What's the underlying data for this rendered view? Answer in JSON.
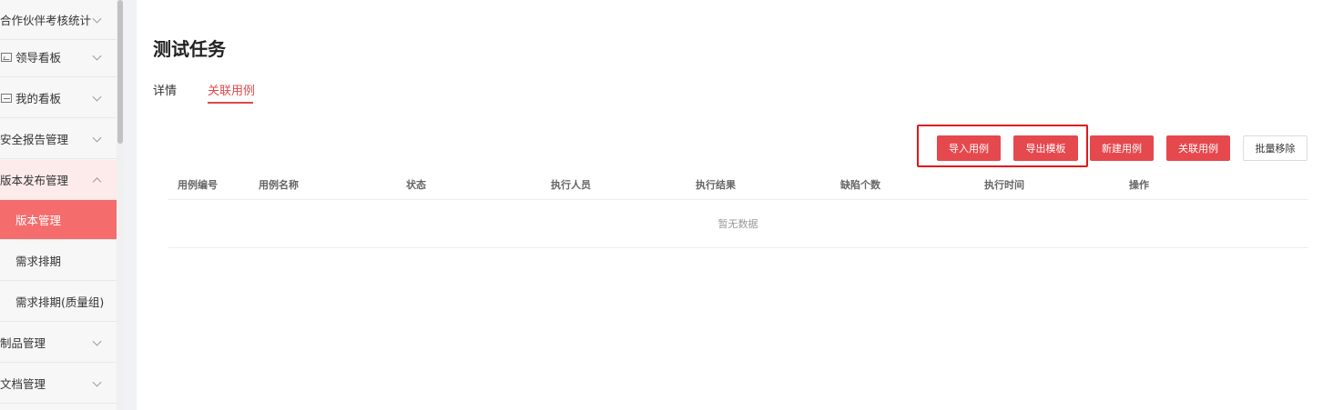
{
  "sidebar": {
    "items": [
      {
        "label": "合作伙伴考核统计",
        "type": "group"
      },
      {
        "label": "领导看板",
        "type": "group",
        "icon": "chart-icon"
      },
      {
        "label": "我的看板",
        "type": "group",
        "icon": "board-icon"
      },
      {
        "label": "安全报告管理",
        "type": "group"
      },
      {
        "label": "版本发布管理",
        "type": "group-open"
      },
      {
        "label": "版本管理",
        "type": "sub-active"
      },
      {
        "label": "需求排期",
        "type": "sub"
      },
      {
        "label": "需求排期(质量组)",
        "type": "sub"
      },
      {
        "label": "制品管理",
        "type": "group"
      },
      {
        "label": "文档管理",
        "type": "group"
      }
    ]
  },
  "main": {
    "title": "测试任务",
    "tabs": [
      {
        "label": "详情",
        "active": false
      },
      {
        "label": "关联用例",
        "active": true
      }
    ],
    "buttons": {
      "import": "导入用例",
      "export_template": "导出模板",
      "create": "新建用例",
      "link": "关联用例",
      "batch_remove": "批量移除"
    },
    "table": {
      "columns": [
        "用例编号",
        "用例名称",
        "状态",
        "执行人员",
        "执行结果",
        "缺陷个数",
        "执行时间",
        "操作"
      ],
      "empty_text": "暂无数据"
    }
  },
  "colors": {
    "accent": "#e5484d",
    "active_menu": "#f56c6c",
    "highlight_box": "#e01818"
  }
}
